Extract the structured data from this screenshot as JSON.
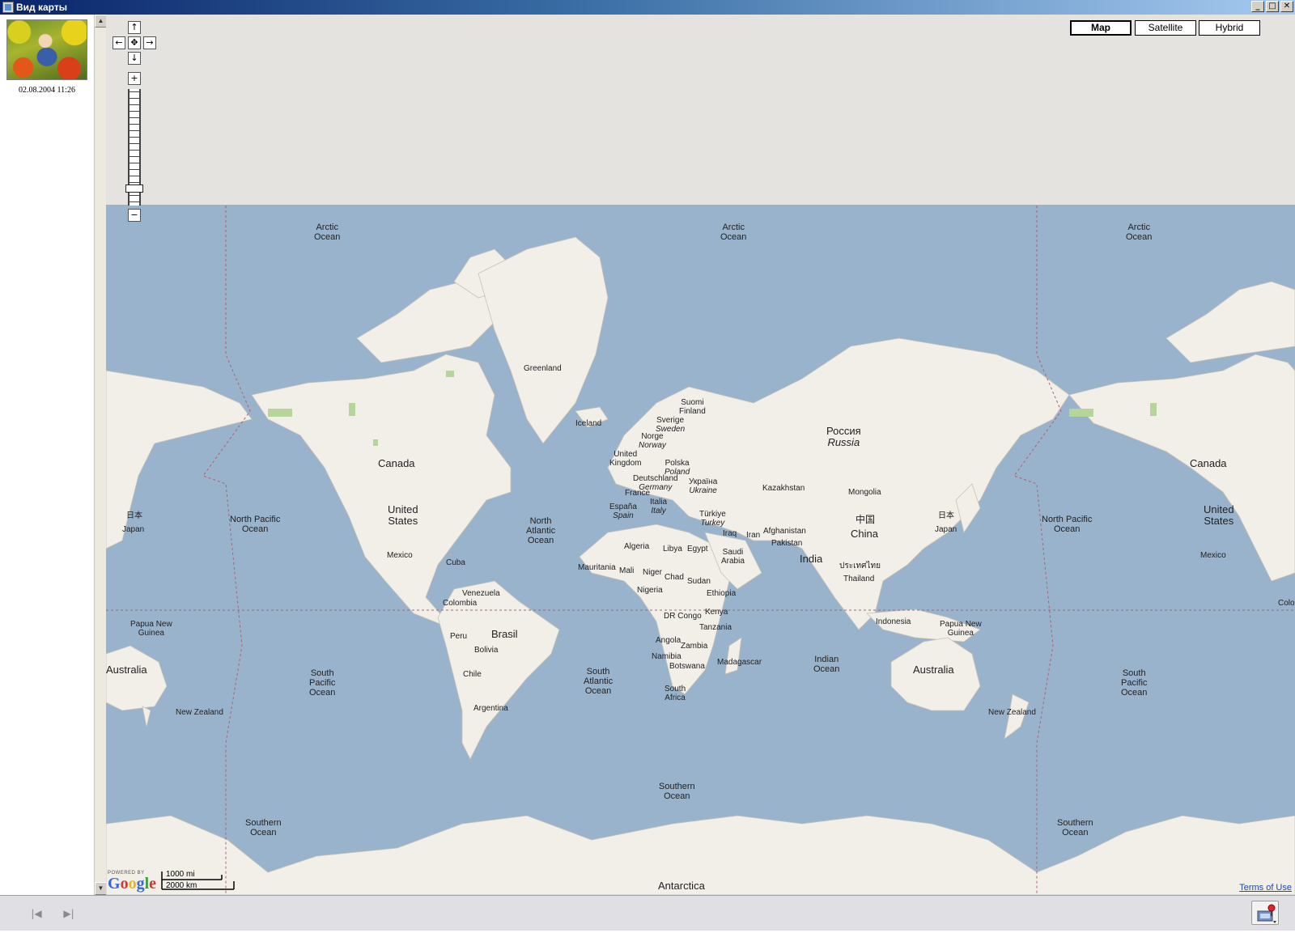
{
  "window": {
    "title": "Вид карты",
    "controls": {
      "minimize": "_",
      "maximize": "□",
      "close": "✕"
    }
  },
  "sidebar": {
    "photo_icon": "photo-thumbnail",
    "photo_date": "02.08.2004 11:26"
  },
  "scrollbar": {
    "up": "▲",
    "down": "▼"
  },
  "map": {
    "type_buttons": {
      "map": "Map",
      "satellite": "Satellite",
      "hybrid": "Hybrid"
    },
    "active_type": "Map",
    "pan": {
      "up": "↑",
      "left": "←",
      "center": "✥",
      "right": "→",
      "down": "↓"
    },
    "zoom": {
      "in": "+",
      "out": "−"
    },
    "labels": {
      "arctic": [
        "Arctic",
        "Ocean"
      ],
      "greenland": "Greenland",
      "iceland": "Iceland",
      "canada": "Canada",
      "united_states": [
        "United",
        "States"
      ],
      "mexico": "Mexico",
      "cuba": "Cuba",
      "north_pacific": [
        "North Pacific",
        "Ocean"
      ],
      "north_atlantic": [
        "North",
        "Atlantic",
        "Ocean"
      ],
      "japan_native": "日本",
      "japan": "Japan",
      "suomi": [
        "Suomi",
        "Finland"
      ],
      "sverige": [
        "Sverige",
        "Sweden"
      ],
      "norge": [
        "Norge",
        "Norway"
      ],
      "uk": [
        "United",
        "Kingdom"
      ],
      "polska": [
        "Polska",
        "Poland"
      ],
      "deutschland": [
        "Deutschland",
        "Germany"
      ],
      "ukraina": [
        "Україна",
        "Ukraine"
      ],
      "france": "France",
      "italia": [
        "Italia",
        "Italy"
      ],
      "espana": [
        "España",
        "Spain"
      ],
      "turkiye": [
        "Türkiye",
        "Turkey"
      ],
      "rossiya": [
        "Россия",
        "Russia"
      ],
      "kazakhstan": "Kazakhstan",
      "mongolia": "Mongolia",
      "china_native": "中国",
      "china": "China",
      "iraq": "Iraq",
      "iran": "Iran",
      "afghanistan": "Afghanistan",
      "pakistan": "Pakistan",
      "india": "India",
      "thailand_native": "ประเทศไทย",
      "thailand": "Thailand",
      "saudi": [
        "Saudi",
        "Arabia"
      ],
      "egypt": "Egypt",
      "libya": "Libya",
      "algeria": "Algeria",
      "mauritania": "Mauritania",
      "mali": "Mali",
      "niger": "Niger",
      "chad": "Chad",
      "sudan": "Sudan",
      "ethiopia": "Ethiopia",
      "nigeria": "Nigeria",
      "kenya": "Kenya",
      "drcongo": "DR Congo",
      "tanzania": "Tanzania",
      "angola": "Angola",
      "zambia": "Zambia",
      "namibia": "Namibia",
      "botswana": "Botswana",
      "madagascar": "Madagascar",
      "south_africa": [
        "South",
        "Africa"
      ],
      "venezuela": "Venezuela",
      "colombia": "Colombia",
      "peru": "Peru",
      "brasil": "Brasil",
      "bolivia": "Bolivia",
      "chile": "Chile",
      "argentina": "Argentina",
      "south_pacific": [
        "South",
        "Pacific",
        "Ocean"
      ],
      "south_atlantic": [
        "South",
        "Atlantic",
        "Ocean"
      ],
      "indian_ocean": [
        "Indian",
        "Ocean"
      ],
      "indonesia": "Indonesia",
      "papua": [
        "Papua New",
        "Guinea"
      ],
      "australia": "Australia",
      "new_zealand": "New Zealand",
      "southern_ocean": [
        "Southern",
        "Ocean"
      ],
      "antarctica": "Antarctica",
      "colo_partial": "Colo"
    },
    "powered_by": "POWERED BY",
    "logo": "Google",
    "scale_mi": "1000 mi",
    "scale_km": "2000 km",
    "terms": "Terms of Use"
  },
  "bottom": {
    "prev": "|◀",
    "next": "▶|",
    "map_icon": "map-pin-icon"
  },
  "colors": {
    "water": "#99b3cc",
    "land": "#f2efe9",
    "grey": "#e5e3df",
    "park": "#b6d59a"
  }
}
